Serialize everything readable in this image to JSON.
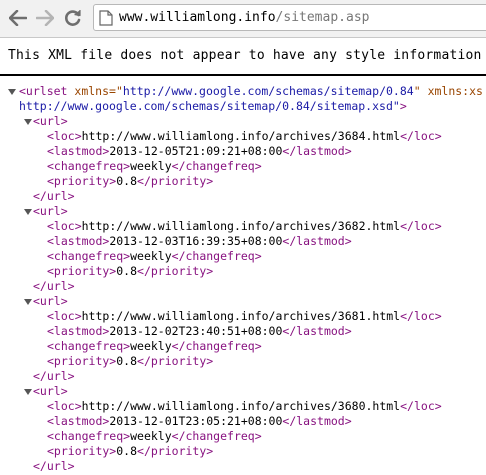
{
  "browser": {
    "url_host": "www.williamlong.info",
    "url_path": "/sitemap.asp",
    "icons": {
      "back": "back-arrow-icon",
      "forward": "forward-arrow-icon",
      "reload": "reload-icon",
      "page": "page-icon"
    }
  },
  "banner": {
    "text": "This XML file does not appear to have any style information"
  },
  "xml": {
    "urlset_open": "<urlset",
    "attr1_name": "xmlns",
    "attr1_eq": "=\"",
    "attr1_value": "http://www.google.com/schemas/sitemap/0.84",
    "attr1_close": "\"",
    "attr2_name": "xmlns:xs",
    "schema_location": "http://www.google.com/schemas/sitemap/0.84/sitemap.xsd\"",
    "schema_close": ">",
    "url_open": "<url>",
    "url_close": "</url>",
    "loc_open": "<loc>",
    "loc_close": "</loc>",
    "lastmod_open": "<lastmod>",
    "lastmod_close": "</lastmod>",
    "changefreq_open": "<changefreq>",
    "changefreq_close": "</changefreq>",
    "priority_open": "<priority>",
    "priority_close": "</priority>",
    "entries": [
      {
        "loc": "http://www.williamlong.info/archives/3684.html",
        "lastmod": "2013-12-05T21:09:21+08:00",
        "changefreq": "weekly",
        "priority": "0.8"
      },
      {
        "loc": "http://www.williamlong.info/archives/3682.html",
        "lastmod": "2013-12-03T16:39:35+08:00",
        "changefreq": "weekly",
        "priority": "0.8"
      },
      {
        "loc": "http://www.williamlong.info/archives/3681.html",
        "lastmod": "2013-12-02T23:40:51+08:00",
        "changefreq": "weekly",
        "priority": "0.8"
      },
      {
        "loc": "http://www.williamlong.info/archives/3680.html",
        "lastmod": "2013-12-01T23:05:21+08:00",
        "changefreq": "weekly",
        "priority": "0.8"
      }
    ]
  }
}
